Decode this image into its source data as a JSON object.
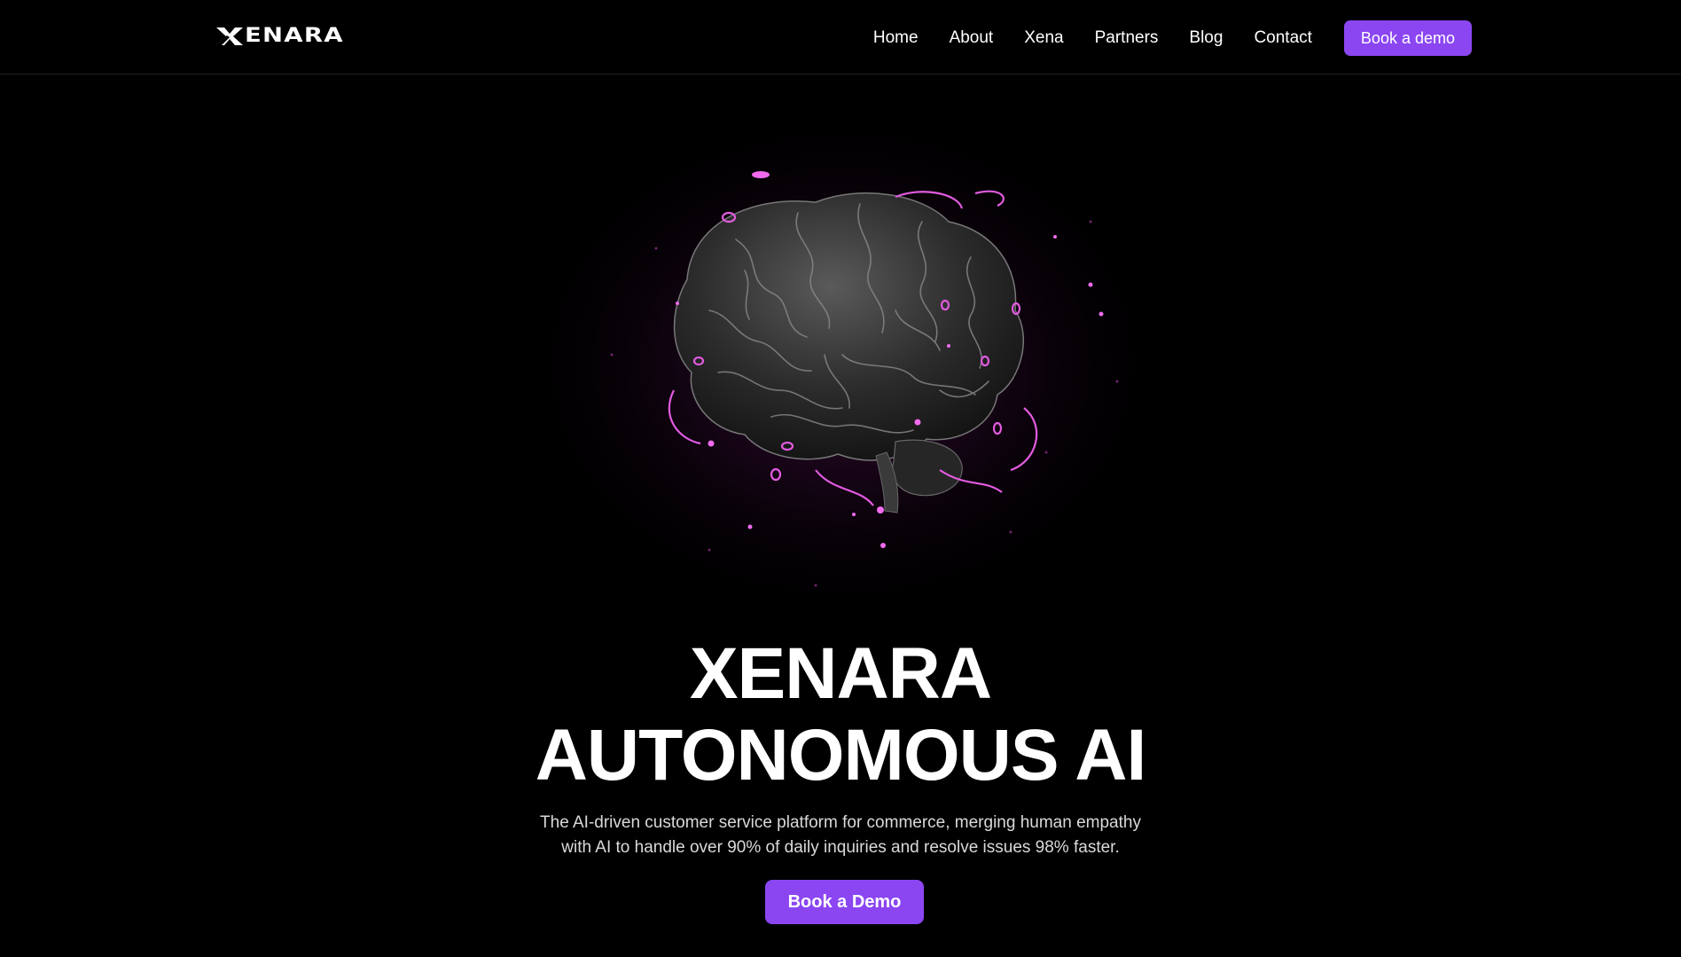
{
  "brand": {
    "name": "ENARA",
    "accent": "#8b46f2"
  },
  "nav": {
    "items": [
      {
        "label": "Home"
      },
      {
        "label": "About"
      },
      {
        "label": "Xena"
      },
      {
        "label": "Partners"
      },
      {
        "label": "Blog"
      },
      {
        "label": "Contact"
      }
    ],
    "cta_label": "Book a demo"
  },
  "hero": {
    "title_line1": "XENARA",
    "title_line2": "AUTONOMOUS AI",
    "subtitle_line1": "The AI-driven customer service platform for commerce, merging human empathy",
    "subtitle_line2": "with AI to handle over 90% of daily inquiries and resolve issues 98% faster.",
    "cta_label": "Book a Demo",
    "image_icon": "brain-illustration"
  }
}
